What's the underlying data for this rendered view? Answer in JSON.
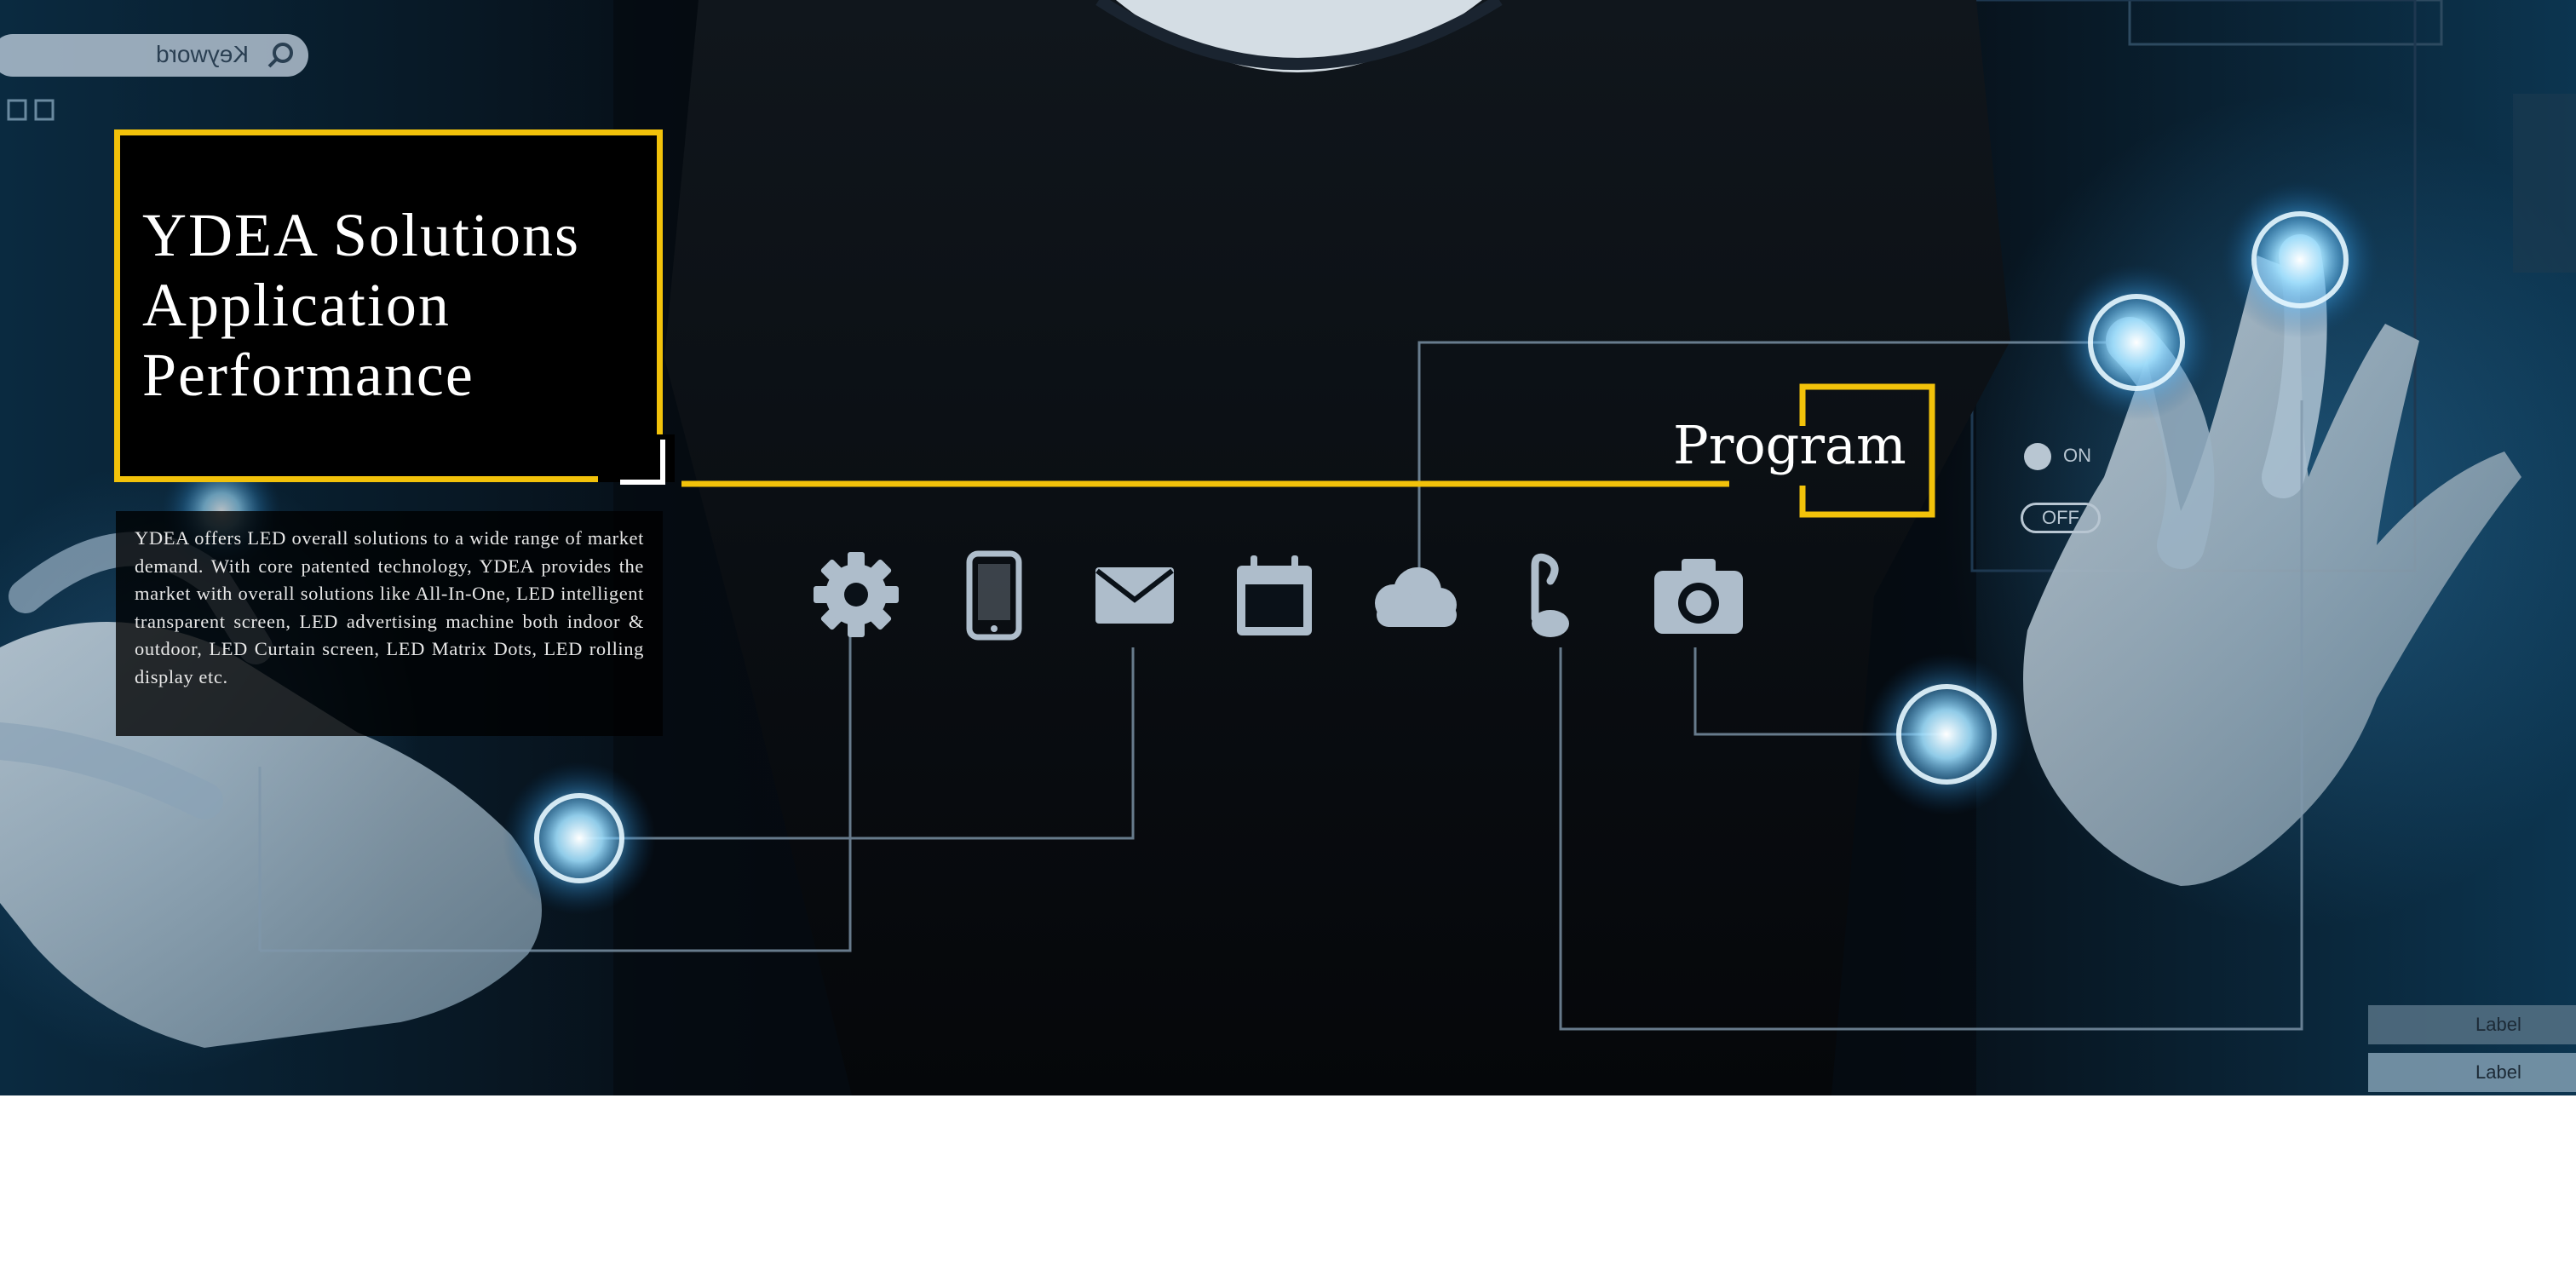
{
  "hero": {
    "title_lines": [
      "YDEA Solutions",
      "Application",
      "Performance"
    ],
    "description": "YDEA offers LED overall solutions to a wide range of market demand. With core patented technology, YDEA provides the market with overall solutions like All-In-One, LED intelligent transparent screen, LED advertising machine both indoor & outdoor, LED Curtain screen, LED Matrix Dots, LED rolling display etc.",
    "program_label": "Program",
    "background_ui": {
      "search_placeholder": "Keyword",
      "toggle_on": "ON",
      "toggle_off": "OFF",
      "label_1": "Label",
      "label_2": "Label"
    }
  },
  "icons": [
    "gear-icon",
    "phone-icon",
    "mail-icon",
    "calendar-icon",
    "cloud-icon",
    "music-icon",
    "camera-icon"
  ],
  "colors": {
    "accent": "#f2c20a",
    "icon": "#aebdcb",
    "line": "#7f97ab",
    "glow": "#6cc6ff"
  }
}
